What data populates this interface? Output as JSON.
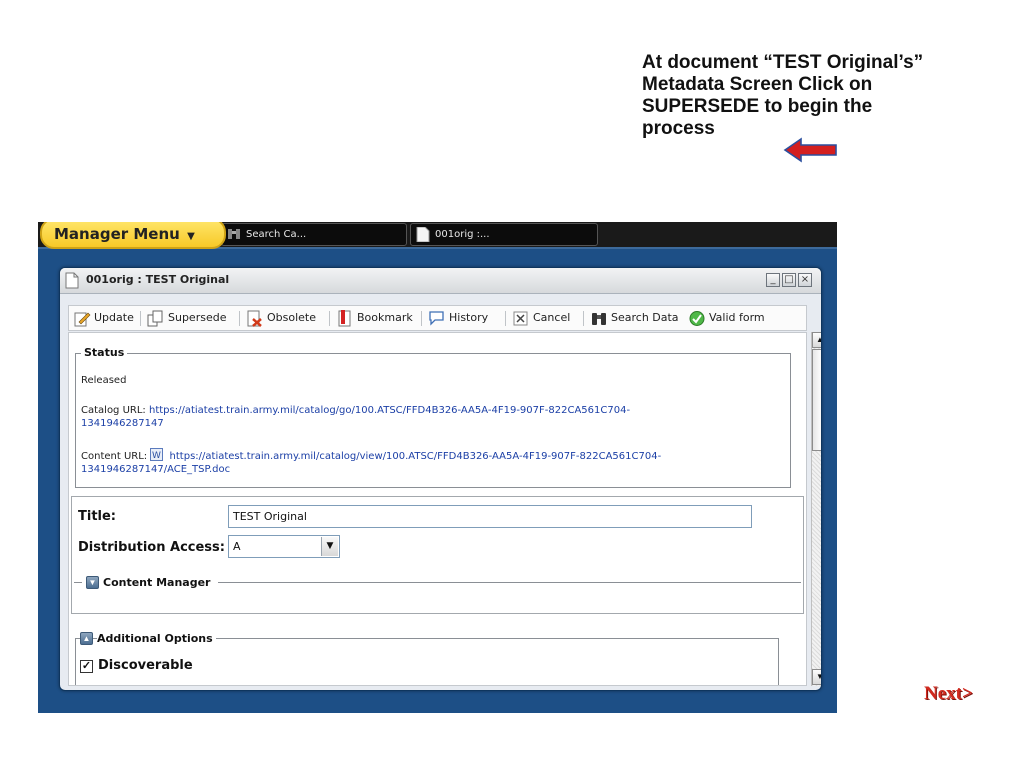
{
  "instruction": {
    "lines": [
      "At document “TEST Original’s”",
      "Metadata Screen Click on",
      "SUPERSEDE to begin the",
      "process"
    ],
    "arrow_color": "#d41f1f"
  },
  "taskbar": {
    "menu_label": "Manager Menu",
    "tasks": [
      {
        "label": "Search Ca...",
        "icon": "binoculars-icon"
      },
      {
        "label": "001orig :...",
        "icon": "document-icon"
      }
    ]
  },
  "window": {
    "title": "001orig : TEST Original",
    "controls": {
      "minimize": "_",
      "maximize": "□",
      "close": "×"
    }
  },
  "toolbar": {
    "update": "Update",
    "supersede": "Supersede",
    "obsolete": "Obsolete",
    "bookmark": "Bookmark",
    "history": "History",
    "cancel": "Cancel",
    "search_data": "Search Data",
    "valid_form": "Valid form"
  },
  "status": {
    "legend": "Status",
    "value": "Released",
    "catalog_label": "Catalog URL:",
    "catalog_url_1": "https://atiatest.train.army.mil/catalog/go/100.ATSC/FFD4B326-AA5A-4F19-907F-822CA561C704-",
    "catalog_url_2": "1341946287147",
    "content_label": "Content URL:",
    "content_url_1": "https://atiatest.train.army.mil/catalog/view/100.ATSC/FFD4B326-AA5A-4F19-907F-822CA561C704-",
    "content_url_2": "1341946287147/ACE_TSP.doc"
  },
  "form": {
    "title_label": "Title:",
    "title_value": "TEST Original",
    "distribution_label": "Distribution Access:",
    "distribution_value": "A",
    "content_manager": "Content Manager",
    "additional_options": "Additional Options",
    "discoverable_label": "Discoverable",
    "discoverable_checked": "✓"
  },
  "nav": {
    "next": "Next>"
  },
  "colors": {
    "accent_blue": "#1d4f86",
    "menu_yellow": "#f7c928",
    "next_red": "#d22a1f"
  }
}
